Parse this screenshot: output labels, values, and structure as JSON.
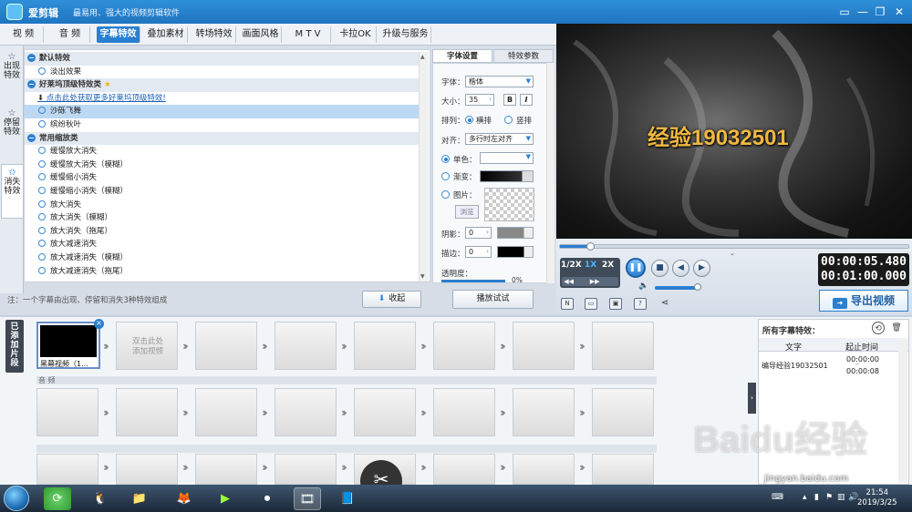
{
  "app": {
    "name": "爱剪辑",
    "slogan": "最易用、强大的视频剪辑软件"
  },
  "tabs": [
    "视 频",
    "音 频",
    "字幕特效",
    "叠加素材",
    "转场特效",
    "画面风格",
    "M T V",
    "卡拉OK",
    "升级与服务"
  ],
  "active_tab_index": 2,
  "side_tabs": [
    "出现特效",
    "停留特效",
    "消失特效"
  ],
  "effects_list": {
    "groups": [
      {
        "label": "默认特效",
        "items": [
          "淡出效果"
        ]
      },
      {
        "label": "好莱坞顶级特效类",
        "link": "点击此处获取更多好莱坞顶级特效!",
        "items": [
          "沙砾飞舞",
          "缤纷秋叶"
        ]
      },
      {
        "label": "常用缩放类",
        "items": [
          "缓慢放大消失",
          "缓慢放大消失（模糊）",
          "缓慢缩小消失",
          "缓慢缩小消失（模糊）",
          "放大消失",
          "放大消失（模糊）",
          "放大消失（拖尾）",
          "放大减速消失",
          "放大减速消失（模糊）",
          "放大减速消失（拖尾）"
        ]
      }
    ],
    "selected": "沙砾飞舞"
  },
  "note": "注：一个字幕由出现、停留和消失3种特效组成",
  "collapse_label": "收起",
  "props_tabs": [
    "字体设置",
    "特效参数"
  ],
  "props": {
    "font_label": "字体：",
    "font_value": "楷体",
    "size_label": "大小：",
    "size_value": "35",
    "bold": "B",
    "italic": "I",
    "arrange_label": "排列：",
    "arrange_h": "横排",
    "arrange_v": "竖排",
    "align_label": "对齐：",
    "align_value": "多行时左对齐",
    "solid_label": "单色：",
    "gradient_label": "渐变：",
    "image_label": "图片：",
    "browse": "浏览",
    "shadow_label": "阴影：",
    "shadow_value": "0",
    "stroke_label": "描边：",
    "stroke_value": "0",
    "opacity_label": "透明度：",
    "opacity_value": "0%"
  },
  "play_test": "播放试试",
  "preview": {
    "subtitle_text": "经验19032501",
    "speeds": [
      "1/2X",
      "1X",
      "2X"
    ],
    "active_speed": "1X",
    "time_current": "00:00:05.480",
    "time_total": "00:01:00.000"
  },
  "export_label": "导出视频",
  "timeline": {
    "added_tab": "已添加片段",
    "first_clip_caption": "黑幕视频（1...",
    "add_hint": "双击此处\n添加视频",
    "audio_label": "音 频"
  },
  "right_panel": {
    "title": "所有字幕特效：",
    "col_text": "文字",
    "col_time": "起止时间",
    "entry_text": "编导经验19032501",
    "entry_start": "00:00:00",
    "entry_end": "00:00:08"
  },
  "taskbar": {
    "time": "21:54",
    "date": "2019/3/25"
  },
  "watermark": {
    "logo": "Baidu经验",
    "url": "jingyan.baidu.com"
  },
  "colors": {
    "accent": "#2b7fd0",
    "subtitle": "#f0b840"
  }
}
